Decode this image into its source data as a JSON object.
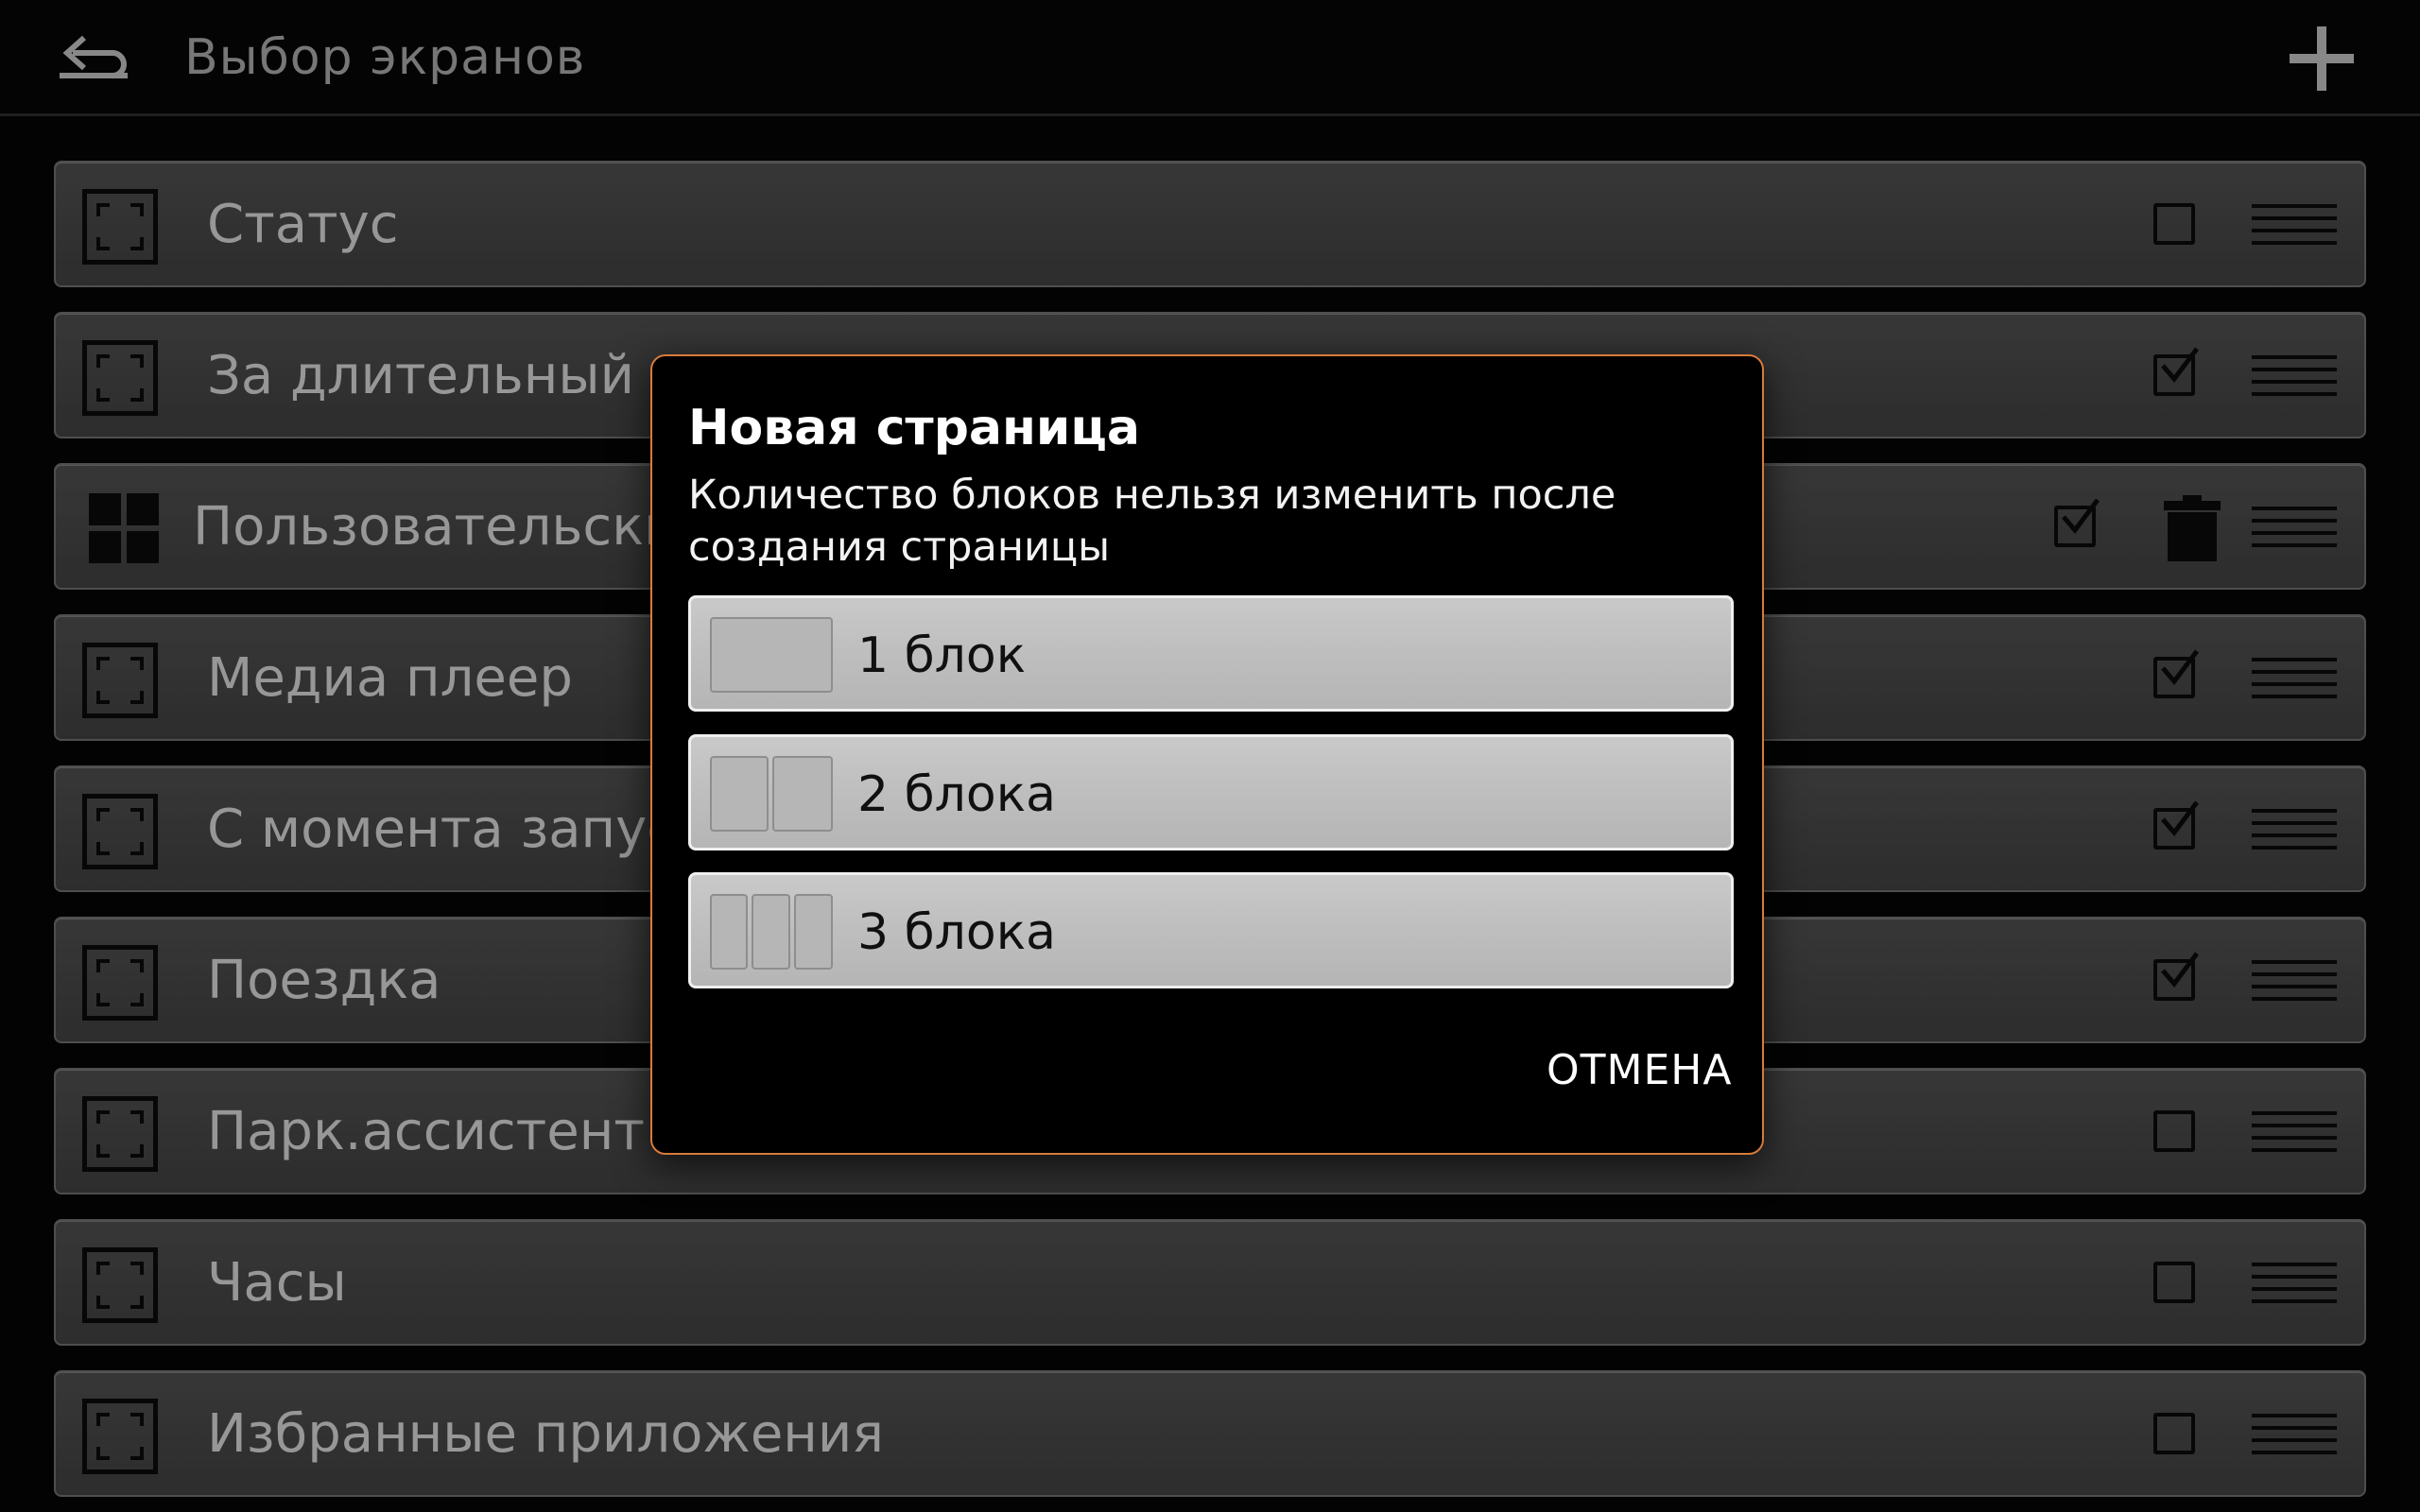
{
  "header": {
    "title": "Выбор экранов",
    "back_icon": "back-arrow-icon",
    "add_icon": "plus-icon"
  },
  "rows": [
    {
      "label": "Статус",
      "icon": "screen-frame-icon",
      "checked": false
    },
    {
      "label": "За длительный п",
      "icon": "screen-frame-icon",
      "checked": true
    },
    {
      "label": "Пользовательски",
      "icon": "grid-blocks-icon",
      "checked": true,
      "deletable": true
    },
    {
      "label": "Медиа плеер",
      "icon": "screen-frame-icon",
      "checked": true
    },
    {
      "label": "С момента запус",
      "icon": "screen-frame-icon",
      "checked": true
    },
    {
      "label": "Поездка",
      "icon": "screen-frame-icon",
      "checked": true
    },
    {
      "label": "Парк.ассистент",
      "icon": "screen-frame-icon",
      "checked": false
    },
    {
      "label": "Часы",
      "icon": "screen-frame-icon",
      "checked": false
    },
    {
      "label": "Избранные приложения",
      "icon": "screen-frame-icon",
      "checked": false
    }
  ],
  "dialog": {
    "title": "Новая страница",
    "message": "Количество блоков нельзя изменить после создания страницы",
    "options": [
      {
        "label": "1 блок",
        "blocks": 1
      },
      {
        "label": "2 блока",
        "blocks": 2
      },
      {
        "label": "3 блока",
        "blocks": 3
      }
    ],
    "cancel_label": "ОТМЕНА",
    "accent_color": "#d87a3b"
  }
}
